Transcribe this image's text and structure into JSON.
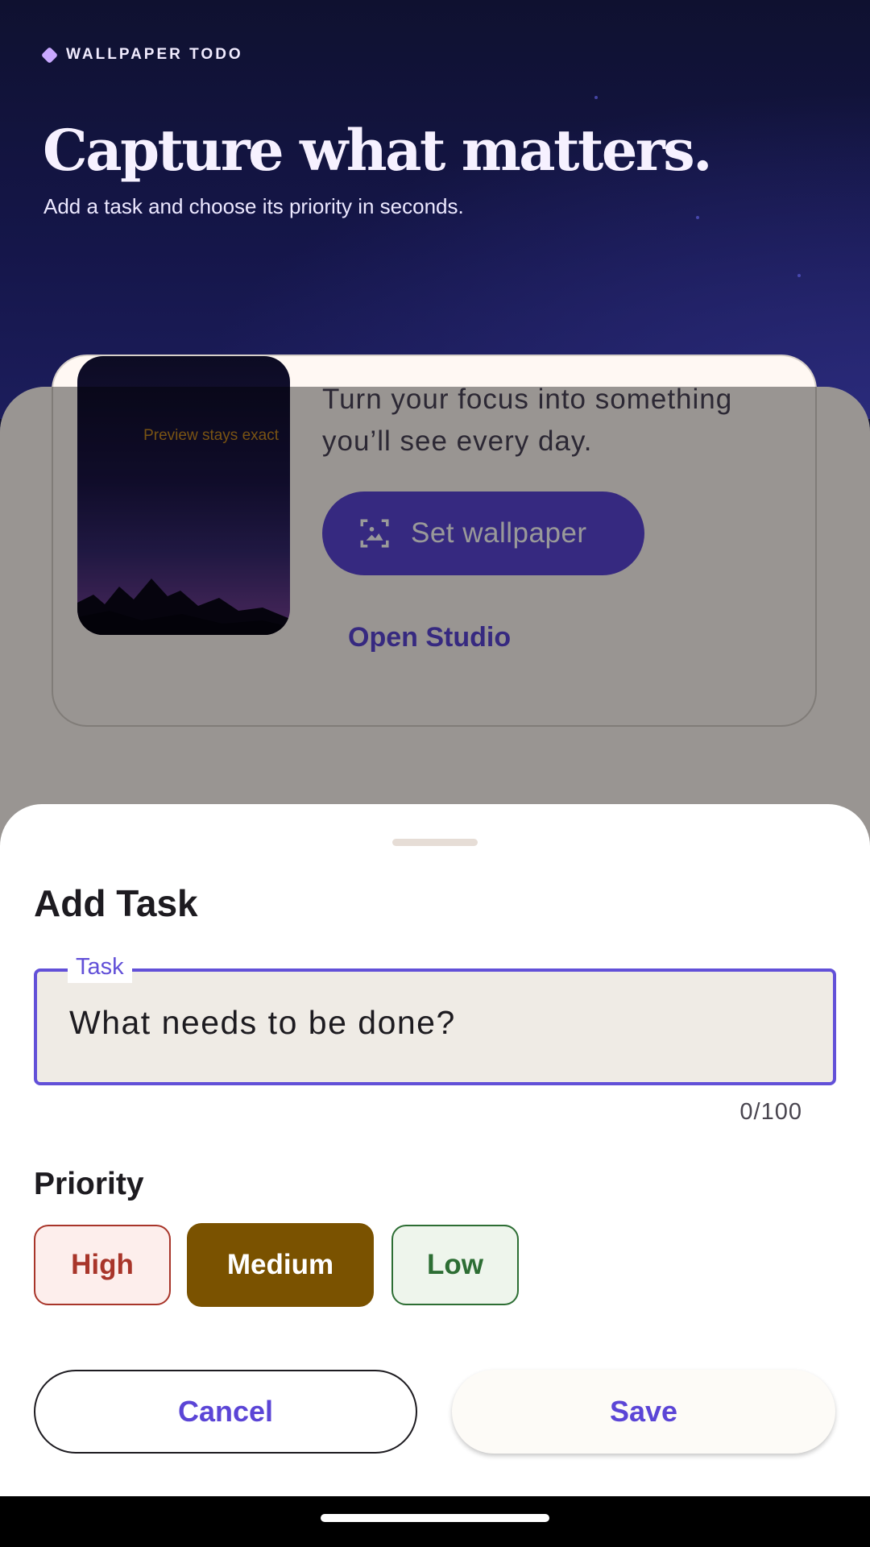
{
  "header": {
    "brand": "WALLPAPER TODO",
    "title": "Capture what matters.",
    "subtitle": "Add a task and choose its priority in seconds."
  },
  "wallpaper_card": {
    "preview_label": "Preview stays exact",
    "description": "Turn your focus into something you’ll see every day.",
    "set_wallpaper_label": "Set wallpaper",
    "open_studio_label": "Open Studio"
  },
  "sheet": {
    "title": "Add Task",
    "task_field": {
      "label": "Task",
      "placeholder": "What needs to be done?",
      "value": "",
      "counter": "0/100"
    },
    "priority": {
      "heading": "Priority",
      "options": [
        "High",
        "Medium",
        "Low"
      ],
      "selected": "Medium"
    },
    "cancel_label": "Cancel",
    "save_label": "Save"
  },
  "colors": {
    "accent": "#5b45d6",
    "high": "#a8352a",
    "medium": "#7a5200",
    "low": "#2d6e34"
  }
}
